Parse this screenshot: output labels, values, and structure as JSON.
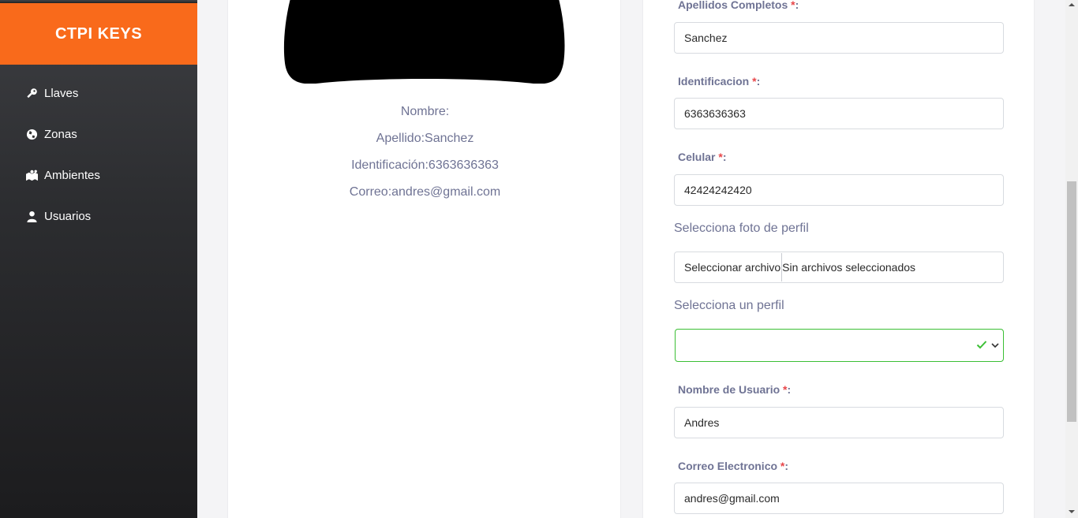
{
  "app": {
    "brand": "CTPI KEYS"
  },
  "sidebar": {
    "items": [
      {
        "label": "Llaves",
        "icon": "key-icon"
      },
      {
        "label": "Zonas",
        "icon": "globe-icon"
      },
      {
        "label": "Ambientes",
        "icon": "map-people-icon"
      },
      {
        "label": "Usuarios",
        "icon": "user-icon"
      }
    ]
  },
  "profile": {
    "nombre": "Nombre:",
    "apellido": "Apellido:Sanchez",
    "identificacion": "Identificación:6363636363",
    "correo": "Correo:andres@gmail.com"
  },
  "form": {
    "apellidos_label": "Apellidos Completos ",
    "apellidos_value": "Sanchez",
    "identificacion_label": "Identificacion ",
    "identificacion_value": "6363636363",
    "celular_label": "Celular ",
    "celular_value": "42424242420",
    "foto_label": "Selecciona foto de perfil",
    "file_button": "Seleccionar archivo",
    "file_status": "Sin archivos seleccionados",
    "perfil_label": "Selecciona un perfil",
    "perfil_value": "",
    "usuario_label": "Nombre de Usuario ",
    "usuario_value": "Andres",
    "correo_label": "Correo Electronico ",
    "correo_value": "andres@gmail.com",
    "required_mark": "*",
    "colon": ":"
  },
  "colors": {
    "brand": "#f96a1b",
    "label": "#6f7394",
    "required": "#e8474a",
    "valid": "#3bbf34"
  }
}
